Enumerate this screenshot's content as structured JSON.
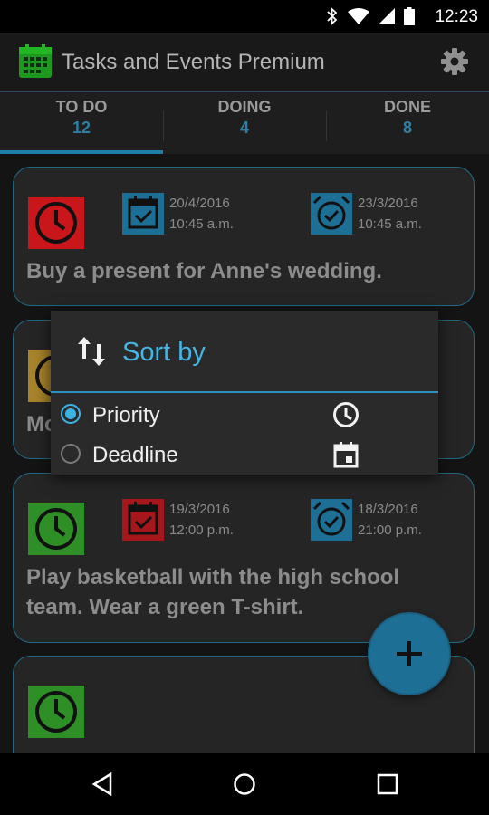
{
  "status": {
    "time": "12:23",
    "icons": [
      "bluetooth-icon",
      "wifi-icon",
      "signal-icon",
      "battery-icon"
    ]
  },
  "app": {
    "title": "Tasks and Events Premium",
    "logo": "calendar-grid-icon",
    "settings_icon": "gear-icon"
  },
  "tabs": [
    {
      "label": "TO DO",
      "count": "12",
      "active": true
    },
    {
      "label": "DOING",
      "count": "4",
      "active": false
    },
    {
      "label": "DONE",
      "count": "8",
      "active": false
    }
  ],
  "tasks": [
    {
      "priority_color": "#c8161a",
      "priority_icon": "clock-icon",
      "deadline_date": "20/4/2016",
      "deadline_time": "10:45 a.m.",
      "deadline_icon": "calendar-check-icon",
      "alarm_date": "23/3/2016",
      "alarm_time": "10:45 a.m.",
      "alarm_icon": "alarm-clock-icon",
      "text": "Buy a present for Anne's wedding."
    },
    {
      "priority_color": "#a8832a",
      "priority_icon": "clock-icon",
      "text": "Mo"
    },
    {
      "priority_color": "#2f8f27",
      "priority_icon": "clock-icon",
      "deadline_date": "19/3/2016",
      "deadline_time": "12:00 p.m.",
      "deadline_icon": "calendar-check-icon",
      "deadline_color": "#a5171b",
      "alarm_date": "18/3/2016",
      "alarm_time": "21:00 p.m.",
      "alarm_icon": "alarm-clock-icon",
      "text": "Play basketball with the high school team. Wear a green T-shirt."
    },
    {
      "priority_color": "#2f8f27",
      "priority_icon": "clock-icon"
    }
  ],
  "dialog": {
    "title": "Sort by",
    "title_icon": "sort-arrows-icon",
    "options": [
      {
        "label": "Priority",
        "checked": true,
        "icon": "clock-icon"
      },
      {
        "label": "Deadline",
        "checked": false,
        "icon": "calendar-icon"
      }
    ]
  },
  "fab": {
    "icon": "plus-icon"
  },
  "navbar": {
    "back": "back-icon",
    "home": "home-icon",
    "recents": "recents-icon"
  }
}
